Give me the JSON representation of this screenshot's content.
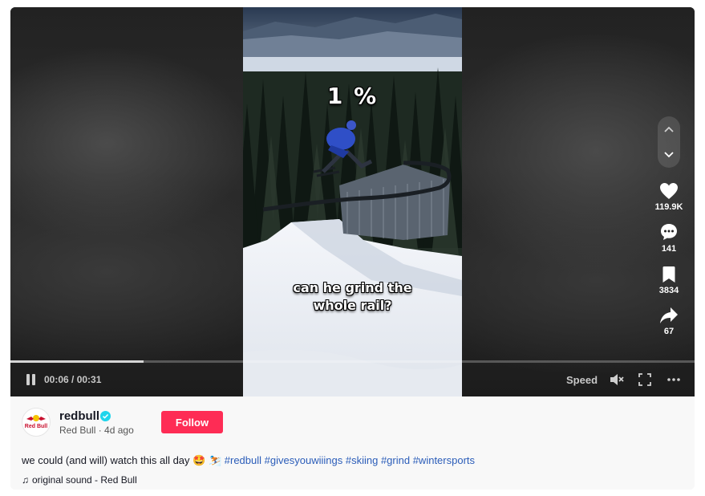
{
  "video": {
    "overlay_percent": "1  %",
    "overlay_caption_line1": "can he grind the",
    "overlay_caption_line2": "whole rail?",
    "progress": 0.195
  },
  "controls": {
    "time": "00:06 / 00:31",
    "speed_label": "Speed"
  },
  "actions": {
    "likes": "119.9K",
    "comments": "141",
    "saves": "3834",
    "shares": "67"
  },
  "author": {
    "username": "redbull",
    "avatar_text": "Red Bull",
    "display_name": "Red Bull",
    "posted": "4d ago",
    "follow_label": "Follow"
  },
  "description": {
    "text": "we could (and will) watch this all day 🤩 ⛷️",
    "hashtags": [
      "#redbull",
      "#givesyouwiiings",
      "#skiing",
      "#grind",
      "#wintersports"
    ]
  },
  "sound": {
    "label": "original sound - Red Bull"
  },
  "colors": {
    "follow": "#fe2c55",
    "hashtag": "#2b5db9",
    "verified": "#20d5ec"
  },
  "icons": [
    "pause-icon",
    "mute-icon",
    "fullscreen-icon",
    "more-icon",
    "chevron-up-icon",
    "chevron-down-icon",
    "heart-icon",
    "comment-icon",
    "bookmark-icon",
    "share-icon",
    "verified-icon",
    "music-note-icon"
  ]
}
